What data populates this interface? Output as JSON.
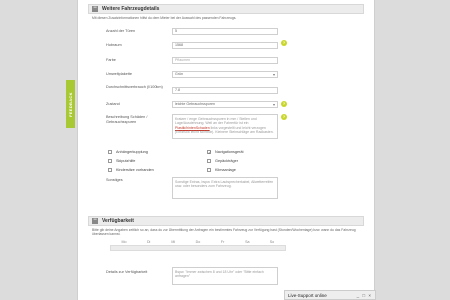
{
  "feedback_tab": "FEEDBACK",
  "section1": {
    "title": "Weitere Fahrzeugdetails",
    "subtitle": "Mit diesen Zusatzinformationen hilfst du dem Mieter bei der Auswahl des passenden Fahrzeugs."
  },
  "fields": {
    "tueren": {
      "label": "Anzahl der Türen",
      "value": "5"
    },
    "hubraum": {
      "label": "Hubraum",
      "value": "1568"
    },
    "farbe": {
      "label": "Farbe",
      "placeholder": "Pflaumen"
    },
    "umweltplakette": {
      "label": "Umweltplakette",
      "value": "Grün"
    },
    "verbrauch": {
      "label": "Durchschnittsverbrauch (l/100km)",
      "value": "7.8"
    },
    "zustand": {
      "label": "Zustand",
      "value": "leichte Gebrauchsspuren"
    },
    "schaeden": {
      "label": "Beschreibung Schäden / Gebrauchsspuren",
      "text_pre": "Kratzer / enge Gebrauchsspuren in mm / Stellen und Lage/Ausdehnung. Weil an der Fahrertür ist ein",
      "text_red": "Plastik/hintenSchaden",
      "text_post": "links vorgestellt und leicht verzogen (Eindruck leicht sichtbar). Kleinere Steinschläge am Radkasten."
    }
  },
  "options": [
    {
      "label": "Anhängerkupplung",
      "checked": false
    },
    {
      "label": "Navigationsgerät",
      "checked": true
    },
    {
      "label": "Skiputzhilfe",
      "checked": false
    },
    {
      "label": "Gepäckträger",
      "checked": false
    },
    {
      "label": "Kindersitze vorhanden",
      "checked": false
    },
    {
      "label": "Klimaanlage",
      "checked": false
    }
  ],
  "sonstiges": {
    "label": "Sonstiges",
    "placeholder": "Sonstige Extras, bspw. Extra Lautsprecherkabel, Allwetterreifen usw. oder besonders zum Fahrzeug."
  },
  "section2": {
    "title": "Verfügbarkeit",
    "subtitle": "Bitte gib deine Angaben zeitlich so an, dass du zur Übermittlung der Anfragen ein bestimmtes Fahrzeug zur Verfügung hast (Stunden/Wochentage) bzw. wann du das Fahrzeug überlassen kannst."
  },
  "days": [
    "Mo",
    "Di",
    "Mi",
    "Do",
    "Fr",
    "Sa",
    "So"
  ],
  "verfuegbar": {
    "label": "Details zur Verfügbarkeit",
    "placeholder": "Bspw. \"Immer zwischen 8 und 18 Uhr\" oder \"Bitte einfach anfragen\""
  },
  "live_support": {
    "label": "Live-Support online",
    "controls": "_ □ ×"
  },
  "colors": {
    "accent": "#a8c934",
    "help": "#c8d62a"
  }
}
